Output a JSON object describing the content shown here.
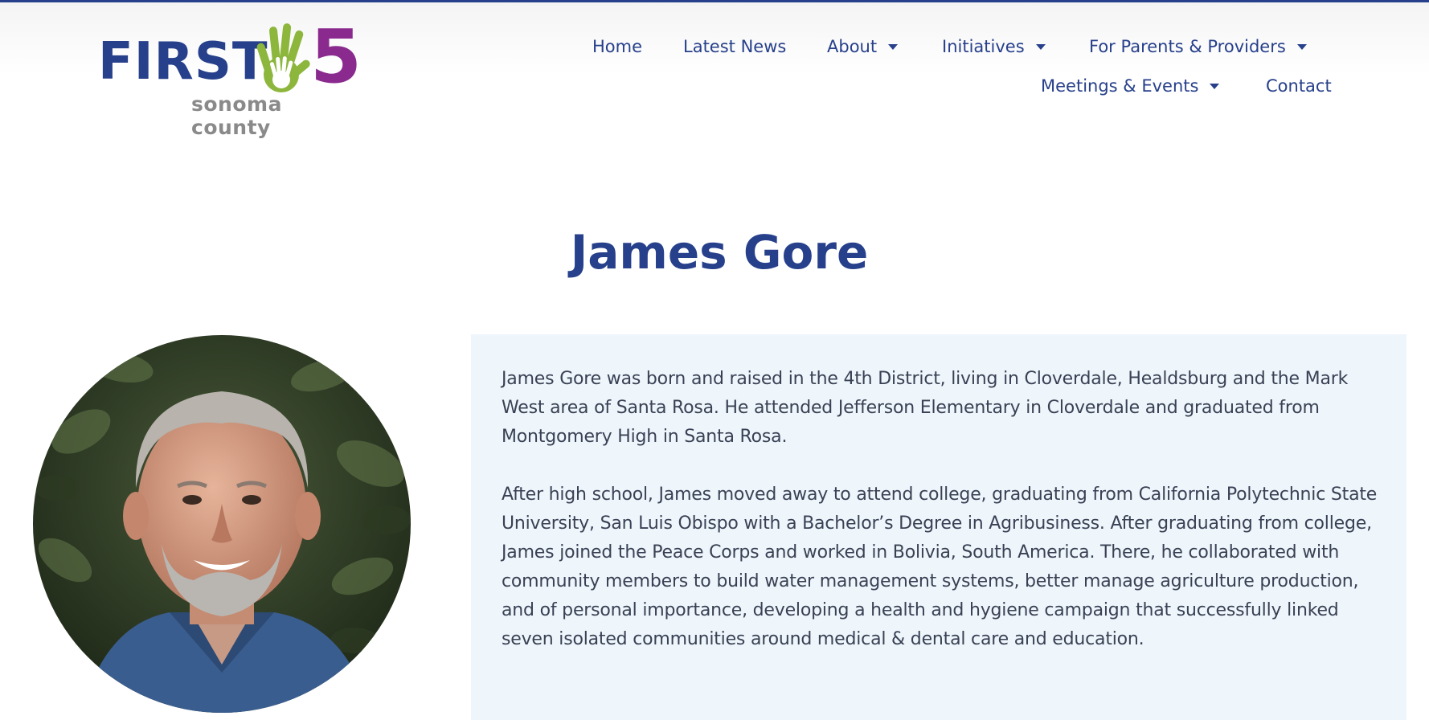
{
  "brand": {
    "logo_first": "FIRST",
    "logo_five": "5",
    "logo_subtitle": "sonoma county",
    "colors": {
      "navy": "#27408b",
      "purple": "#8a2a8e",
      "green": "#8db63c",
      "gray": "#8a8a8a"
    }
  },
  "nav": {
    "items": [
      {
        "label": "Home",
        "has_dropdown": false
      },
      {
        "label": "Latest News",
        "has_dropdown": false
      },
      {
        "label": "About",
        "has_dropdown": true
      },
      {
        "label": "Initiatives",
        "has_dropdown": true
      },
      {
        "label": "For Parents & Providers",
        "has_dropdown": true
      },
      {
        "label": "Meetings & Events",
        "has_dropdown": true
      },
      {
        "label": "Contact",
        "has_dropdown": false
      }
    ]
  },
  "page": {
    "title": "James Gore"
  },
  "bio": {
    "paragraphs": [
      "James Gore was born and raised in the 4th District, living in Cloverdale, Healdsburg and the Mark West area of Santa Rosa. He attended Jefferson Elementary in Cloverdale and graduated from Montgomery High in Santa Rosa.",
      "After high school, James moved away to attend college, graduating from California Polytechnic State University, San Luis Obispo with a Bachelor’s Degree in Agribusiness. After graduating from college, James joined the Peace Corps and worked in Bolivia, South America. There, he collaborated with community members to build water management systems, better manage agriculture production, and of personal importance, developing a health and hygiene campaign that successfully linked seven isolated communities around medical & dental care and education."
    ],
    "background_color": "#eef6fc"
  }
}
